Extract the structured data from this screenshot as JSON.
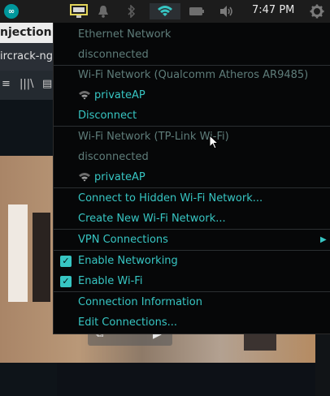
{
  "panel": {
    "clock": "7:47 PM",
    "icons": [
      "arduino-app-icon",
      "monitor-icon",
      "bell-icon",
      "bluetooth-icon",
      "wifi-icon",
      "battery-icon",
      "volume-icon",
      "gear-icon"
    ],
    "accent": "#37c6c3"
  },
  "background_app": {
    "tab_title": "njection -",
    "url_text": "ircrack-ng/",
    "video_overlay_colors": [
      "#a98567",
      "#b3a191"
    ]
  },
  "network_menu": {
    "ethernet_header": "Ethernet Network",
    "ethernet_status": "disconnected",
    "wifi1_header": "Wi-Fi Network (Qualcomm Atheros AR9485)",
    "wifi1_network": "privateAP",
    "disconnect": "Disconnect",
    "wifi2_header": "Wi-Fi Network (TP-Link Wi-Fi)",
    "wifi2_status": "disconnected",
    "wifi2_network": "privateAP",
    "connect_hidden": "Connect to Hidden Wi-Fi Network...",
    "create_new": "Create New Wi-Fi Network...",
    "vpn": "VPN Connections",
    "enable_networking": "Enable Networking",
    "enable_wifi": "Enable Wi-Fi",
    "connection_info": "Connection Information",
    "edit_connections": "Edit Connections...",
    "enable_networking_checked": true,
    "enable_wifi_checked": true
  }
}
